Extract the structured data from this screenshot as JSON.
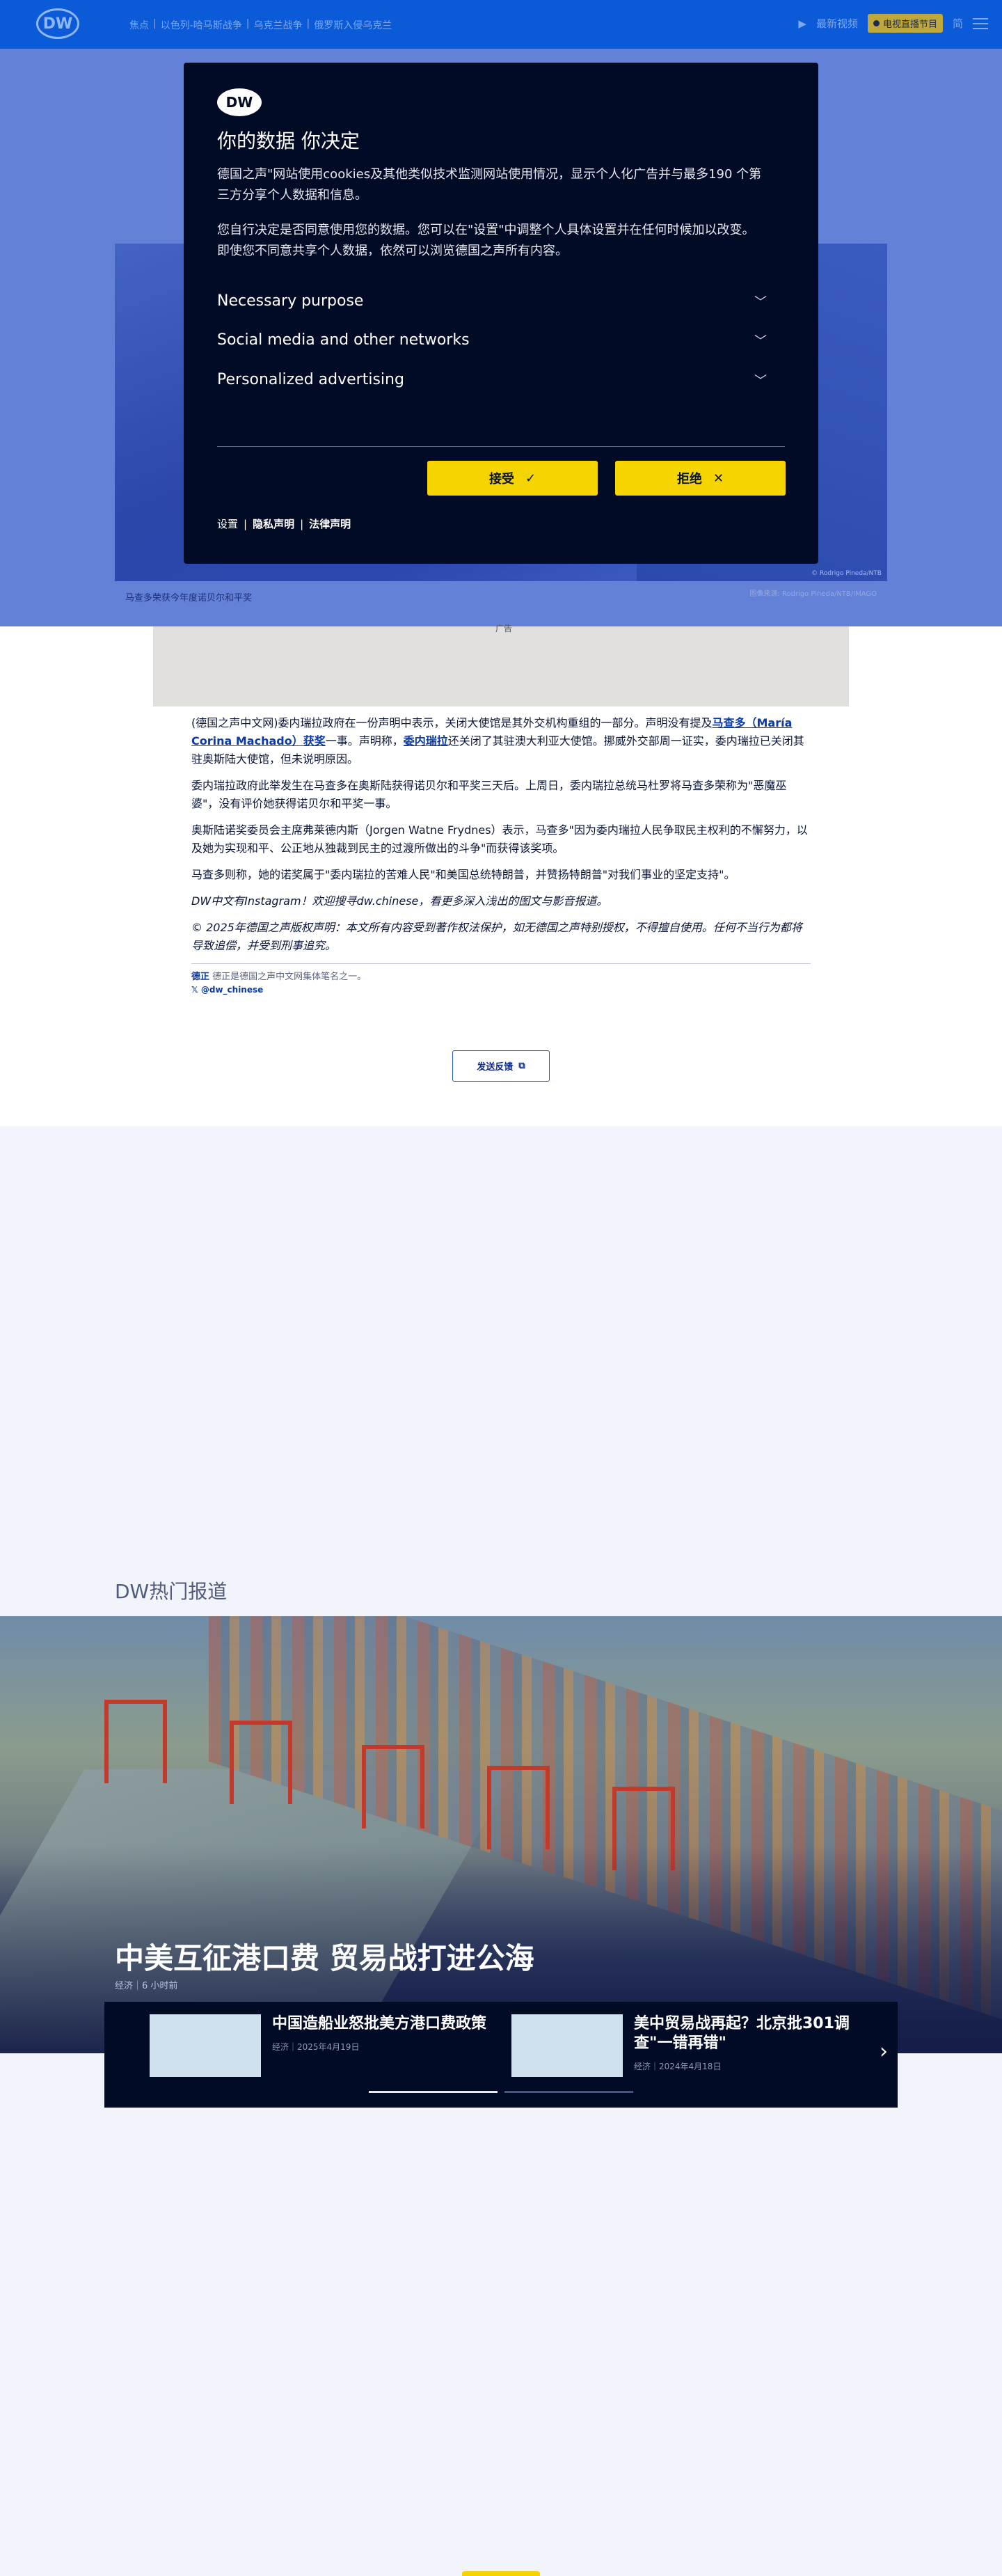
{
  "header": {
    "logo": "DW",
    "nav": [
      "焦点",
      "以色列-哈马斯战争",
      "乌克兰战争",
      "俄罗斯入侵乌克兰"
    ],
    "latest_video": "最新视频",
    "live_label": "电视直播节目",
    "lang": "简"
  },
  "hero": {
    "caption": "马查多荣获今年度诺贝尔和平奖",
    "credit": "图像来源: Rodrigo Pineda/NTB/IMAGO",
    "credit_small": "© Rodrigo Pineda/NTB",
    "fragment": "广告"
  },
  "consent": {
    "logo": "DW",
    "title": "你的数据 你决定",
    "para1": "德国之声\"网站使用cookies及其他类似技术监测网站使用情况，显示个人化广告并与最多190 个第三方分享个人数据和信息。",
    "para2": "您自行决定是否同意使用您的数据。您可以在\"设置\"中调整个人具体设置并在任何时候加以改变。即使您不同意共享个人数据，依然可以浏览德国之声所有内容。",
    "sections": [
      "Necessary purpose",
      "Social media and other networks",
      "Personalized advertising"
    ],
    "accept": "接受",
    "reject": "拒绝",
    "footer": {
      "settings": "设置",
      "privacy": "隐私声明",
      "legal": "法律声明"
    }
  },
  "article": {
    "p1_a": "(德国之声中文网)委内瑞拉政府在一份声明中表示，关闭大使馆是其外交机构重组的一部分。声明没有提及",
    "p1_link": "马查多（María Corina Machado）获奖",
    "p1_b": "一事。声明称，",
    "p1_link2": "委内瑞拉",
    "p1_c": "还关闭了其驻澳大利亚大使馆。挪威外交部周一证实，委内瑞拉已关闭其驻奥斯陆大使馆，但未说明原因。",
    "p2": "委内瑞拉政府此举发生在马查多在奥斯陆获得诺贝尔和平奖三天后。上周日，委内瑞拉总统马杜罗将马查多荣称为\"恶魔巫婆\"，没有评价她获得诺贝尔和平奖一事。",
    "p3": "奥斯陆诺奖委员会主席弗莱德内斯（Jorgen Watne Frydnes）表示，马查多\"因为委内瑞拉人民争取民主权利的不懈努力，以及她为实现和平、公正地从独裁到民主的过渡所做出的斗争\"而获得该奖项。",
    "p4": "马查多则称，她的诺奖属于\"委内瑞拉的苦难人民\"和美国总统特朗普，并赞扬特朗普\"对我们事业的坚定支持\"。",
    "p5": "DW中文有Instagram！欢迎搜寻dw.chinese，看更多深入浅出的图文与影音报道。",
    "p6": "© 2025年德国之声版权声明：本文所有内容受到著作权法保护，如无德国之声特别授权，不得擅自使用。任何不当行为都将导致追偿，并受到刑事追究。",
    "author_name": "德正",
    "author_desc": "德正是德国之声中文网集体笔名之一。",
    "x_handle": "@dw_chinese",
    "feedback": "发送反馈"
  },
  "trending": {
    "section_title": "DW热门报道",
    "headline": "中美互征港口费 贸易战打进公海",
    "meta": "经济｜6 小时前",
    "cards": [
      {
        "title": "中国造船业怒批美方港口费政策",
        "meta": "经济｜2025年4月19日"
      },
      {
        "title": "美中贸易战再起？北京批301调查\"一错再错\"",
        "meta": "经济｜2024年4月18日"
      }
    ]
  }
}
